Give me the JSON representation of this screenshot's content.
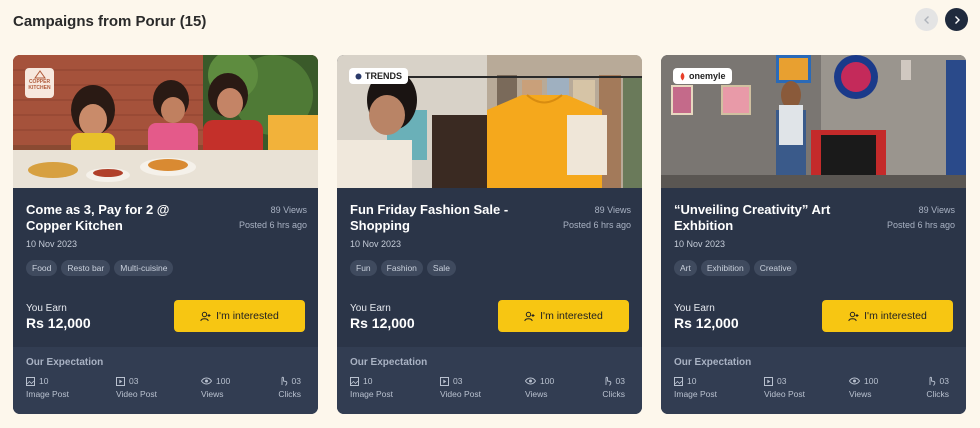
{
  "header": {
    "title": "Campaigns from Porur (15)"
  },
  "cards": [
    {
      "brand": {
        "line1": "COPPER",
        "line2": "KITCHEN"
      },
      "title": "Come as 3, Pay for 2 @ Copper Kitchen",
      "views": "89 Views",
      "posted": "Posted 6 hrs ago",
      "date": "10 Nov 2023",
      "tags": [
        "Food",
        "Resto bar",
        "Multi-cuisine"
      ],
      "earn_label": "You Earn",
      "earn_value": "Rs 12,000",
      "button_label": "I'm interested",
      "expectation": {
        "title": "Our Expectation",
        "image_post": {
          "value": "10",
          "label": "Image Post"
        },
        "video_post": {
          "value": "03",
          "label": "Video Post"
        },
        "views": {
          "value": "100",
          "label": "Views"
        },
        "clicks": {
          "value": "03",
          "label": "Clicks"
        }
      }
    },
    {
      "brand": {
        "line1": "TRENDS"
      },
      "title": "Fun Friday Fashion Sale - Shopping",
      "views": "89 Views",
      "posted": "Posted 6 hrs ago",
      "date": "10 Nov 2023",
      "tags": [
        "Fun",
        "Fashion",
        "Sale"
      ],
      "earn_label": "You Earn",
      "earn_value": "Rs 12,000",
      "button_label": "I'm interested",
      "expectation": {
        "title": "Our Expectation",
        "image_post": {
          "value": "10",
          "label": "Image Post"
        },
        "video_post": {
          "value": "03",
          "label": "Video Post"
        },
        "views": {
          "value": "100",
          "label": "Views"
        },
        "clicks": {
          "value": "03",
          "label": "Clicks"
        }
      }
    },
    {
      "brand": {
        "line1": "onemyle"
      },
      "title": "“Unveiling Creativity” Art Exhbition",
      "views": "89 Views",
      "posted": "Posted 6 hrs ago",
      "date": "10 Nov 2023",
      "tags": [
        "Art",
        "Exhibition",
        "Creative"
      ],
      "earn_label": "You Earn",
      "earn_value": "Rs 12,000",
      "button_label": "I'm interested",
      "expectation": {
        "title": "Our Expectation",
        "image_post": {
          "value": "10",
          "label": "Image Post"
        },
        "video_post": {
          "value": "03",
          "label": "Video Post"
        },
        "views": {
          "value": "100",
          "label": "Views"
        },
        "clicks": {
          "value": "03",
          "label": "Clicks"
        }
      }
    }
  ],
  "colors": {
    "page_bg": "#fdf7ec",
    "card_bg": "#2b3548",
    "accent_button": "#f7c612",
    "nav_active": "#1f2a3d"
  }
}
